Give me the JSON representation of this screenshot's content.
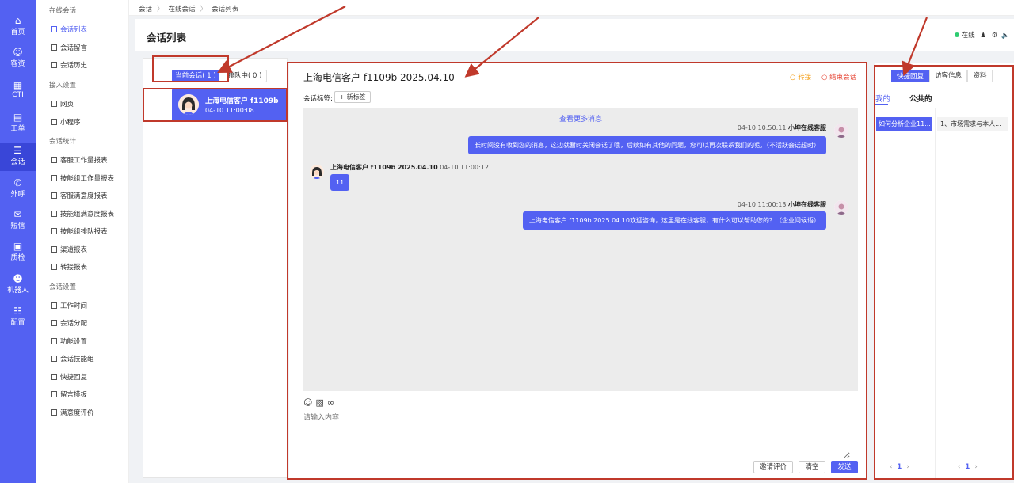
{
  "nav": [
    {
      "label": "首页",
      "icon": "home-icon",
      "glyph": "⌂"
    },
    {
      "label": "客资",
      "icon": "customers-icon",
      "glyph": "☺"
    },
    {
      "label": "CTI",
      "icon": "cti-icon",
      "glyph": "▦"
    },
    {
      "label": "工单",
      "icon": "ticket-icon",
      "glyph": "▤"
    },
    {
      "label": "会话",
      "icon": "chat-icon",
      "glyph": "☰"
    },
    {
      "label": "外呼",
      "icon": "phone-icon",
      "glyph": "✆"
    },
    {
      "label": "短信",
      "icon": "sms-icon",
      "glyph": "✉"
    },
    {
      "label": "质检",
      "icon": "quality-icon",
      "glyph": "▣"
    },
    {
      "label": "机器人",
      "icon": "robot-icon",
      "glyph": "☻"
    },
    {
      "label": "配置",
      "icon": "settings-sliders-icon",
      "glyph": "☷"
    }
  ],
  "submenu": {
    "group1": "在线会话",
    "g1_items": [
      "会话列表",
      "会话留言",
      "会话历史"
    ],
    "group2": "接入设置",
    "g2_items": [
      "网页",
      "小程序"
    ],
    "group3": "会话统计",
    "g3_items": [
      "客服工作量报表",
      "技能组工作量报表",
      "客服满意度报表",
      "技能组满意度报表",
      "技能组排队报表",
      "渠道报表",
      "转接报表"
    ],
    "group4": "会话设置",
    "g4_items": [
      "工作时间",
      "会话分配",
      "功能设置",
      "会话技能组",
      "快捷回复",
      "留言模板",
      "满意度评价"
    ]
  },
  "breadcrumb": [
    "会话",
    "在线会话",
    "会话列表"
  ],
  "header": {
    "title": "会话列表",
    "status": "在线",
    "user_glyph": "♟",
    "gear_glyph": "⚙",
    "sound_glyph": "🔈"
  },
  "session_list": {
    "tab_current": "当前会话( 1 )",
    "tab_queue": "排队中( 0 )",
    "item_name": "上海电信客户 f1109b 20...",
    "item_time": "04-10 11:00:08"
  },
  "chat": {
    "title": "上海电信客户 f1109b 2025.04.10",
    "transfer": "○ 转接",
    "end": "○ 结束会话",
    "tag_label": "会话标签:",
    "tag_add": "+ 新标签",
    "more": "查看更多消息",
    "messages": [
      {
        "time": "04-10 10:50:11",
        "sender": "小坤在线客服",
        "text": "长时间没有收到您的消息，这边就暂时关闭会话了哦，后续如有其他的问题，您可以再次联系我们的呢。（不活跃会话超时）"
      },
      {
        "sender": "上海电信客户 f1109b 2025.04.10",
        "time": "04-10 11:00:12",
        "text": "11"
      },
      {
        "time": "04-10 11:00:13",
        "sender": "小坤在线客服",
        "text": "上海电信客户 f1109b 2025.04.10欢迎咨询，这里是在线客服，有什么可以帮助您的？（企业问候语）"
      }
    ],
    "tool_emoji": "☺",
    "tool_image": "▨",
    "tool_link": "∞",
    "input_placeholder": "请输入内容",
    "btn_eval": "邀请评价",
    "btn_clear": "清空",
    "btn_send": "发送"
  },
  "right": {
    "tabs": [
      "快捷回复",
      "访客信息",
      "资料"
    ],
    "sub_mine": "我的",
    "sub_public": "公共的",
    "category": "如何分析企业11...",
    "reply": "1、市场需求与本人...",
    "pager_prev": "‹",
    "pager_page": "1",
    "pager_next": "›"
  },
  "colors": {
    "accent": "#5361f2",
    "annotation": "#c0392b"
  }
}
